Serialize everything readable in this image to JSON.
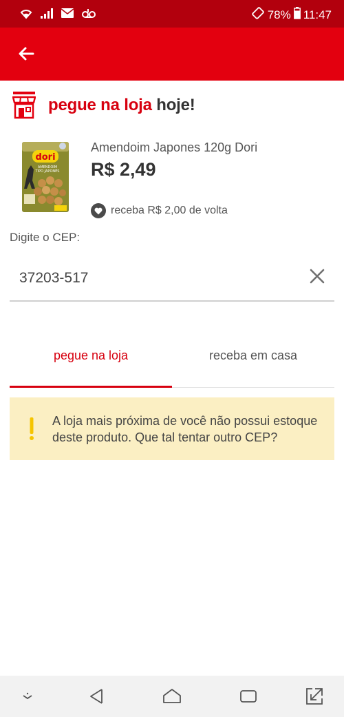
{
  "status_bar": {
    "battery": "78%",
    "time": "11:47",
    "left_icons": [
      "wifi-icon",
      "signal-icon",
      "mail-icon",
      "voicemail-icon"
    ],
    "right_icons": [
      "rotate-icon",
      "battery-icon"
    ]
  },
  "app_bar": {
    "back_icon": "arrow-left-icon",
    "color": "#e3000f"
  },
  "store_header": {
    "icon": "store-icon",
    "title_highlight": "pegue na loja",
    "title_rest": " hoje!"
  },
  "product": {
    "image_brand": "dori",
    "image_caption": "AMENDOIM TIPO JAPONÊS",
    "name": "Amendoim Japones 120g Dori",
    "price": "R$ 2,49",
    "cashback": "receba R$ 2,00 de volta",
    "cashback_icon": "heart-icon"
  },
  "cep": {
    "label": "Digite o CEP:",
    "value": "37203-517",
    "clear_icon": "close-icon"
  },
  "tabs": [
    {
      "label": "pegue na loja",
      "active": true
    },
    {
      "label": "receba em casa",
      "active": false
    }
  ],
  "warning": {
    "icon": "exclamation-icon",
    "line1": "A loja mais próxima de você não possui estoque",
    "line2": "deste produto. Que tal tentar outro CEP?"
  },
  "nav_bar": {
    "icons": [
      "chevron-down-icon",
      "back-triangle-icon",
      "home-icon",
      "recents-icon",
      "expand-icon"
    ]
  },
  "colors": {
    "brand_red": "#e3000f",
    "status_red": "#b2000d",
    "warning_bg": "#fbefc3",
    "warning_icon": "#f5c400"
  }
}
